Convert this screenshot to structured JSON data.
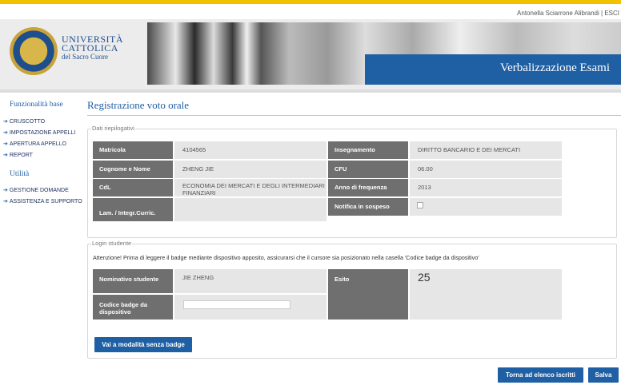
{
  "header": {
    "user": "Antonella Sciarrone Alibrandi",
    "separator": "|",
    "logout": "ESCI",
    "logo_line1": "UNIVERSITÀ",
    "logo_line2": "CATTOLICA",
    "logo_line3": "del Sacro Cuore",
    "app_title": "Verbalizzazione Esami"
  },
  "sidebar": {
    "section1": "Funzionalità base",
    "items1": [
      "CRUSCOTTO",
      "IMPOSTAZIONE APPELLI",
      "APERTURA APPELLO",
      "REPORT"
    ],
    "section2": "Utilità",
    "items2": [
      "GESTIONE DOMANDE",
      "ASSISTENZA E SUPPORTO"
    ]
  },
  "page": {
    "title": "Registrazione voto orale"
  },
  "summary": {
    "legend": "Dati riepilogativi",
    "matricola_label": "Matricola",
    "matricola_value": "4104565",
    "nome_label": "Cognome e Nome",
    "nome_value": "ZHENG JIE",
    "cdl_label": "CdL",
    "cdl_value": "ECONOMIA DEI MERCATI E DEGLI INTERMEDIARI FINANZIARI",
    "lam_label": "Lam. / Integr.Curric.",
    "insegnamento_label": "Insegnamento",
    "insegnamento_value": "DIRITTO BANCARIO E DEI MERCATI",
    "cfu_label": "CFU",
    "cfu_value": "06.00",
    "anno_label": "Anno di frequenza",
    "anno_value": "2013",
    "notifica_label": "Notifica in sospeso"
  },
  "login": {
    "legend": "Login studente",
    "notice": "Attenzione! Prima di leggere il badge mediante dispositivo apposito, assicurarsi che il cursore sia posizionato nella casella 'Codice badge da dispositivo'",
    "nominativo_label": "Nominativo studente",
    "nominativo_value": "JIE  ZHENG",
    "badge_label": "Codice badge da dispositivo",
    "esito_label": "Esito",
    "esito_value": "25",
    "no_badge_button": "Vai a modalità senza badge"
  },
  "footer": {
    "back_button": "Torna ad elenco iscritti",
    "save_button": "Salva"
  },
  "colors": {
    "accent": "#1f5fa3",
    "topbar": "#f2c200",
    "label_bg": "#6f6f6f",
    "value_bg": "#e6e6e6"
  }
}
